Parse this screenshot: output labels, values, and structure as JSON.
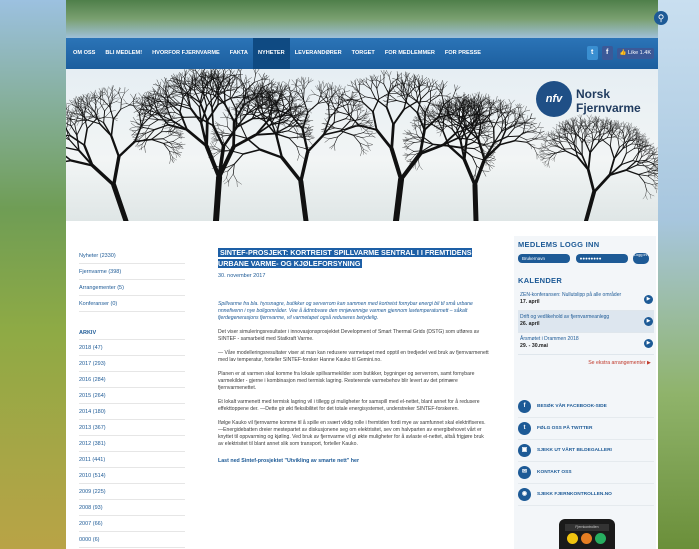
{
  "nav": {
    "items": [
      "OM OSS",
      "BLI MEDLEM!",
      "HVORFOR FJERNVARME",
      "FAKTA",
      "NYHETER",
      "LEVERANDØRER",
      "TORGET",
      "FOR MEDLEMMER",
      "FOR PRESSE"
    ],
    "active": "NYHETER",
    "like_label": "Like",
    "like_count": "1.4K"
  },
  "logo": {
    "short": "nfv",
    "line1": "Norsk",
    "line2": "Fjernvarme"
  },
  "left": {
    "cats": [
      "Nyheter (2330)",
      "Fjernvarme (398)",
      "Arrangementer (5)",
      "Konferanser (0)"
    ],
    "archive_heading": "ARKIV",
    "years": [
      "2018 (47)",
      "2017 (293)",
      "2016 (284)",
      "2015 (264)",
      "2014 (180)",
      "2013 (367)",
      "2012 (381)",
      "2011 (441)",
      "2010 (514)",
      "2009 (225)",
      "2008 (93)",
      "2007 (66)",
      "0000 (6)"
    ]
  },
  "article": {
    "title": "SINTEF-PROSJEKT: KORTREIST SPILLVARME SENTRAL I I FREMTIDENS URBANE VARME- OG KJØLEFORSYNING",
    "date": "30. november 2017",
    "lead": "Spillvarme fra bla. hyssnagre, butikker og serverrom kan sammen med kortreist fornybar energi bli til små urbane nnnefivenn i nye boligområder. Vee å ådnnbvare den mnjøvennige varmen gjennom lavtemperaturnett – såkalt fjerdegenerasjons fjernvarme, vil varmetapet også reduseres betydelig.",
    "p1": "Det viser simuleringsresultater i innovasjonsprosjektet Development of Smart Thermal Grids (DSTG) som utføres av SINTEF - samarbeid med Statkraft Varme.",
    "p2": "— Våre modelleringsresultater viser at man kan redusere varmetapet med opptil en tredjedel ved bruk av fjernvarmenett med lav temperatur, forteller SINTEF-forsker Hanne Kauko til Gemini.no.",
    "p3": "Planen er at varmen skal komme fra lokale spillvarmekilder som butikker, bygninger og serverrom, samt fornybare varmekilder - gjerne i kombinasjon med termisk lagring. Resterende varmebehov blir levert av det primære fjernvarmenettet.",
    "p4": "Et lokalt varmenett med termisk lagring vil i tillegg gi muligheter for samspill med el-nettet, blant annet for å redusere effekttoppene der. —Dette gir økt fleksibilitet for det totale energisystemet, understreker SINTEF-forskeren.",
    "p5": "Ifølge Kauko vil fjernvarme komme til å spille en svært viktig rolle i fremtiden fordi mye av samfunnet skal elektrifiseres.\n—Energidebatten dreier mestepartet av diskusjonene seg om elektrisitet, sev om halvparten av energibehovet vårt er knyttet til oppvarming og kjøling. Ved bruk av fjernvarme vil gi økte muligheter for å avlaste el-nettet, altså frigjøre bruk av elektrisitet til blant annet slik som transport, forteller Kauko.",
    "link": "Last ned Sintef-prosjektet \"Utvikling av smarte nett\" her"
  },
  "login": {
    "heading": "MEDLEMS LOGG INN",
    "user_placeholder": "Brukernavn",
    "pass_placeholder": "●●●●●●●●",
    "button": "Logg inn"
  },
  "calendar": {
    "heading": "KALENDER",
    "events": [
      {
        "name": "ZEN-konferansen: Nullutslipp på alle områder",
        "date": "17. april"
      },
      {
        "name": "Drift og vedlikehold av fjernvarmeanlegg",
        "date": "26. april"
      },
      {
        "name": "Årsmøtet i Drammen 2018",
        "date": "29. - 30.mai"
      }
    ],
    "more": "Se ekstra arrangementer ▶"
  },
  "quick_links": [
    {
      "icon": "facebook-icon",
      "glyph": "f",
      "label": "BESØK VÅR FACEBOOK-SIDE"
    },
    {
      "icon": "twitter-icon",
      "glyph": "t",
      "label": "FØLG OSS PÅ TWITTER"
    },
    {
      "icon": "gallery-icon",
      "glyph": "▣",
      "label": "SJEKK UT VÅRT BILDEGALLERI"
    },
    {
      "icon": "contact-icon",
      "glyph": "✉",
      "label": "KONTAKT OSS"
    },
    {
      "icon": "control-icon",
      "glyph": "◉",
      "label": "SJEKK FJERNKONTROLLEN.NO"
    }
  ],
  "phone": {
    "screen": "Fjernkontrollen"
  }
}
